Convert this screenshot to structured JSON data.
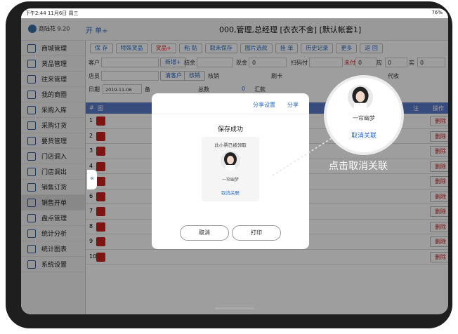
{
  "status": {
    "time_date": "下午2:44 11月6日 周三",
    "battery": "76%"
  },
  "header": {
    "user": "商陆花 9.20",
    "open_title": "开 单+",
    "main_title": "000,管理,总经理 [衣衣不舍] [默认帐套1]"
  },
  "sidebar": {
    "items": [
      "商城管理",
      "货品管理",
      "往来管理",
      "我的商圈",
      "采购入库",
      "采购订货",
      "要货管理",
      "门店调入",
      "门店调出",
      "销售订货",
      "销售开单",
      "盘点管理",
      "统计分析",
      "统计图表",
      "系统设置"
    ]
  },
  "toolbar": [
    "保 存",
    "特殊货品",
    "货品+",
    "粘 贴",
    "取未保存",
    "图片选款",
    "挂 单",
    "历史记录",
    "更多",
    "返 回"
  ],
  "form": {
    "customer_label": "客户",
    "new_btn": "新增+",
    "settle_label": "结余",
    "cash_label": "现金",
    "cash_value": "0",
    "scan_label": "扫码付",
    "unpaid": "未付",
    "unpaid_value": "0",
    "due_label": "应",
    "due_value": "0",
    "paid_label": "实",
    "paid_value": "0",
    "clerk_label": "店员",
    "clear_btn": "清客户",
    "verify_btn": "核销",
    "verify_label": "核销",
    "card_label": "刷卡",
    "collect_label": "代收",
    "date_label": "日期",
    "date_value": "2019-11-06",
    "note_label": "备",
    "total_label": "总数",
    "total_value": "0",
    "remit_label": "汇款"
  },
  "grid": {
    "col_num": "#",
    "col_img": "图",
    "col_qty": "数量",
    "col_note": "注",
    "col_op": "操作",
    "rows": [
      "1",
      "2",
      "3",
      "4",
      "5",
      "6",
      "7",
      "8",
      "9",
      "10"
    ],
    "delete": "删除"
  },
  "dialog": {
    "share_settings": "分享设置",
    "share": "分享",
    "title": "保存成功",
    "claimed": "此小票已被领取",
    "name": "一帘幽梦",
    "unlink": "取消关联",
    "cancel": "取消",
    "print": "打印"
  },
  "zoom": {
    "name": "一帘幽梦",
    "unlink": "取消关联"
  },
  "callout": "点击取消关联",
  "colors": {
    "accent": "#2a6cc7",
    "grid_header": "#5a79c9",
    "danger": "#cc2222"
  }
}
